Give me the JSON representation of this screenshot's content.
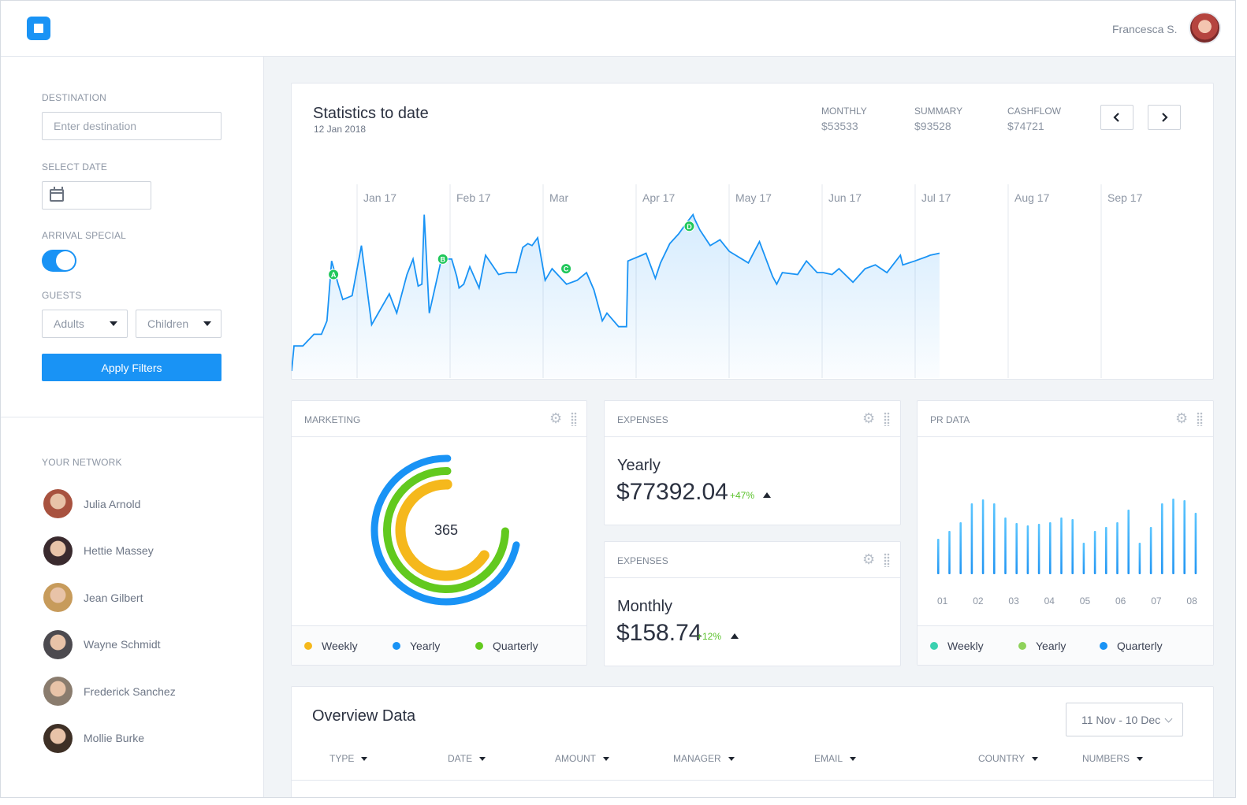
{
  "header": {
    "username": "Francesca S."
  },
  "sidebar": {
    "destination_label": "DESTINATION",
    "destination_placeholder": "Enter destination",
    "date_label": "SELECT DATE",
    "arrival_label": "ARRIVAL SPECIAL",
    "guests_label": "GUESTS",
    "adults": "Adults",
    "children": "Children",
    "apply_label": "Apply Filters",
    "network_label": "YOUR NETWORK",
    "network": [
      {
        "name": "Julia Arnold",
        "color": "#a8523f"
      },
      {
        "name": "Hettie Massey",
        "color": "#3a2a2e"
      },
      {
        "name": "Jean Gilbert",
        "color": "#c79b5b"
      },
      {
        "name": "Wayne Schmidt",
        "color": "#4c4a4f"
      },
      {
        "name": "Frederick Sanchez",
        "color": "#8a7c6e"
      },
      {
        "name": "Mollie Burke",
        "color": "#3e3026"
      }
    ]
  },
  "stats": {
    "title": "Statistics to date",
    "date": "12 Jan 2018",
    "monthly_label": "MONTHLY",
    "monthly_value": "$53533",
    "summary_label": "SUMMARY",
    "summary_value": "$93528",
    "cashflow_label": "CASHFLOW",
    "cashflow_value": "$74721",
    "prev_icon": "chevron-left-icon",
    "next_icon": "chevron-right-icon"
  },
  "marketing": {
    "title": "MARKETING",
    "center": "365",
    "legend": [
      {
        "label": "Weekly",
        "color": "#f5b81c"
      },
      {
        "label": "Yearly",
        "color": "#1993f5"
      },
      {
        "label": "Quarterly",
        "color": "#62c91e"
      }
    ]
  },
  "expenses_yearly": {
    "title": "EXPENSES",
    "label": "Yearly",
    "value": "$77392.04",
    "change": "+47%"
  },
  "expenses_monthly": {
    "title": "EXPENSES",
    "label": "Monthly",
    "value": "$158.74",
    "change": "+12%"
  },
  "pr": {
    "title": "PR DATA",
    "legend": [
      {
        "label": "Weekly",
        "color": "#3ad1b0"
      },
      {
        "label": "Yearly",
        "color": "#8ed25a"
      },
      {
        "label": "Quarterly",
        "color": "#1993f5"
      }
    ]
  },
  "overview": {
    "title": "Overview Data",
    "date_range": "11 Nov - 10 Dec",
    "columns": [
      "TYPE",
      "DATE",
      "AMOUNT",
      "MANAGER",
      "EMAIL",
      "COUNTRY",
      "NUMBERS"
    ]
  },
  "chart_data": [
    {
      "type": "area",
      "x_ticks": [
        "Jan 17",
        "Feb 17",
        "Mar",
        "Apr 17",
        "May 17",
        "Jun 17",
        "Jul 17",
        "Aug 17",
        "Sep 17"
      ],
      "x": [
        0,
        0.05,
        0.24,
        0.48,
        0.64,
        0.76,
        0.86,
        1.0,
        1.1,
        1.3,
        1.5,
        1.72,
        2.1,
        2.26,
        2.48,
        2.61,
        2.72,
        2.8,
        2.85,
        2.96,
        3.22,
        3.44,
        3.55,
        3.6,
        3.7,
        3.83,
        4.03,
        4.17,
        4.45,
        4.62,
        4.83,
        4.97,
        5.08,
        5.17,
        5.29,
        5.45,
        5.6,
        5.91,
        6.14,
        6.34,
        6.5,
        6.68,
        6.78,
        7.03,
        7.2,
        7.23,
        7.53,
        7.62,
        7.82,
        7.93,
        8.13,
        8.32,
        8.5,
        8.63,
        8.66,
        8.78,
        9.0,
        9.21,
        9.41,
        9.82,
        9.95,
        10.06,
        10.34,
        10.43,
        10.55,
        10.88,
        11.07,
        11.3,
        11.43,
        11.62,
        11.77,
        12.07,
        12.33,
        12.55,
        12.8,
        13.09,
        13.14,
        13.4,
        13.63,
        13.73,
        13.93
      ],
      "y": [
        0,
        13,
        13,
        19,
        19,
        26,
        57,
        45,
        37,
        39,
        65,
        24,
        40,
        30,
        50,
        58,
        44,
        45,
        81,
        30,
        58,
        58,
        49,
        43,
        45,
        54,
        43,
        60,
        50,
        51,
        51,
        64,
        66,
        65,
        69,
        47,
        53,
        45,
        47,
        51,
        42,
        26,
        30,
        23,
        23,
        57,
        60,
        61,
        48,
        56,
        66,
        71,
        77,
        81,
        79,
        73,
        65,
        68,
        62,
        56,
        62,
        67,
        49,
        45,
        51,
        50,
        57,
        51,
        51,
        50,
        53,
        46,
        53,
        55,
        51,
        60,
        55,
        57,
        59,
        60,
        61
      ],
      "markers": [
        {
          "label": "A",
          "x": 0.9,
          "y": 50
        },
        {
          "label": "B",
          "x": 3.25,
          "y": 58
        },
        {
          "label": "C",
          "x": 5.9,
          "y": 53
        },
        {
          "label": "D",
          "x": 8.55,
          "y": 75
        }
      ]
    },
    {
      "type": "radial",
      "series": [
        {
          "name": "Yearly",
          "value": 0.72,
          "color": "#1993f5"
        },
        {
          "name": "Quarterly",
          "value": 0.75,
          "color": "#62c91e"
        },
        {
          "name": "Weekly",
          "value": 0.66,
          "color": "#f5b81c"
        }
      ]
    },
    {
      "type": "bar",
      "categories": [
        "01",
        "02",
        "03",
        "04",
        "05",
        "06",
        "07",
        "08"
      ],
      "values": [
        45,
        55,
        66,
        90,
        95,
        90,
        72,
        65,
        62,
        64,
        66,
        72,
        70,
        40,
        55,
        60,
        66,
        82,
        40,
        60,
        90,
        96,
        94,
        78
      ]
    }
  ]
}
